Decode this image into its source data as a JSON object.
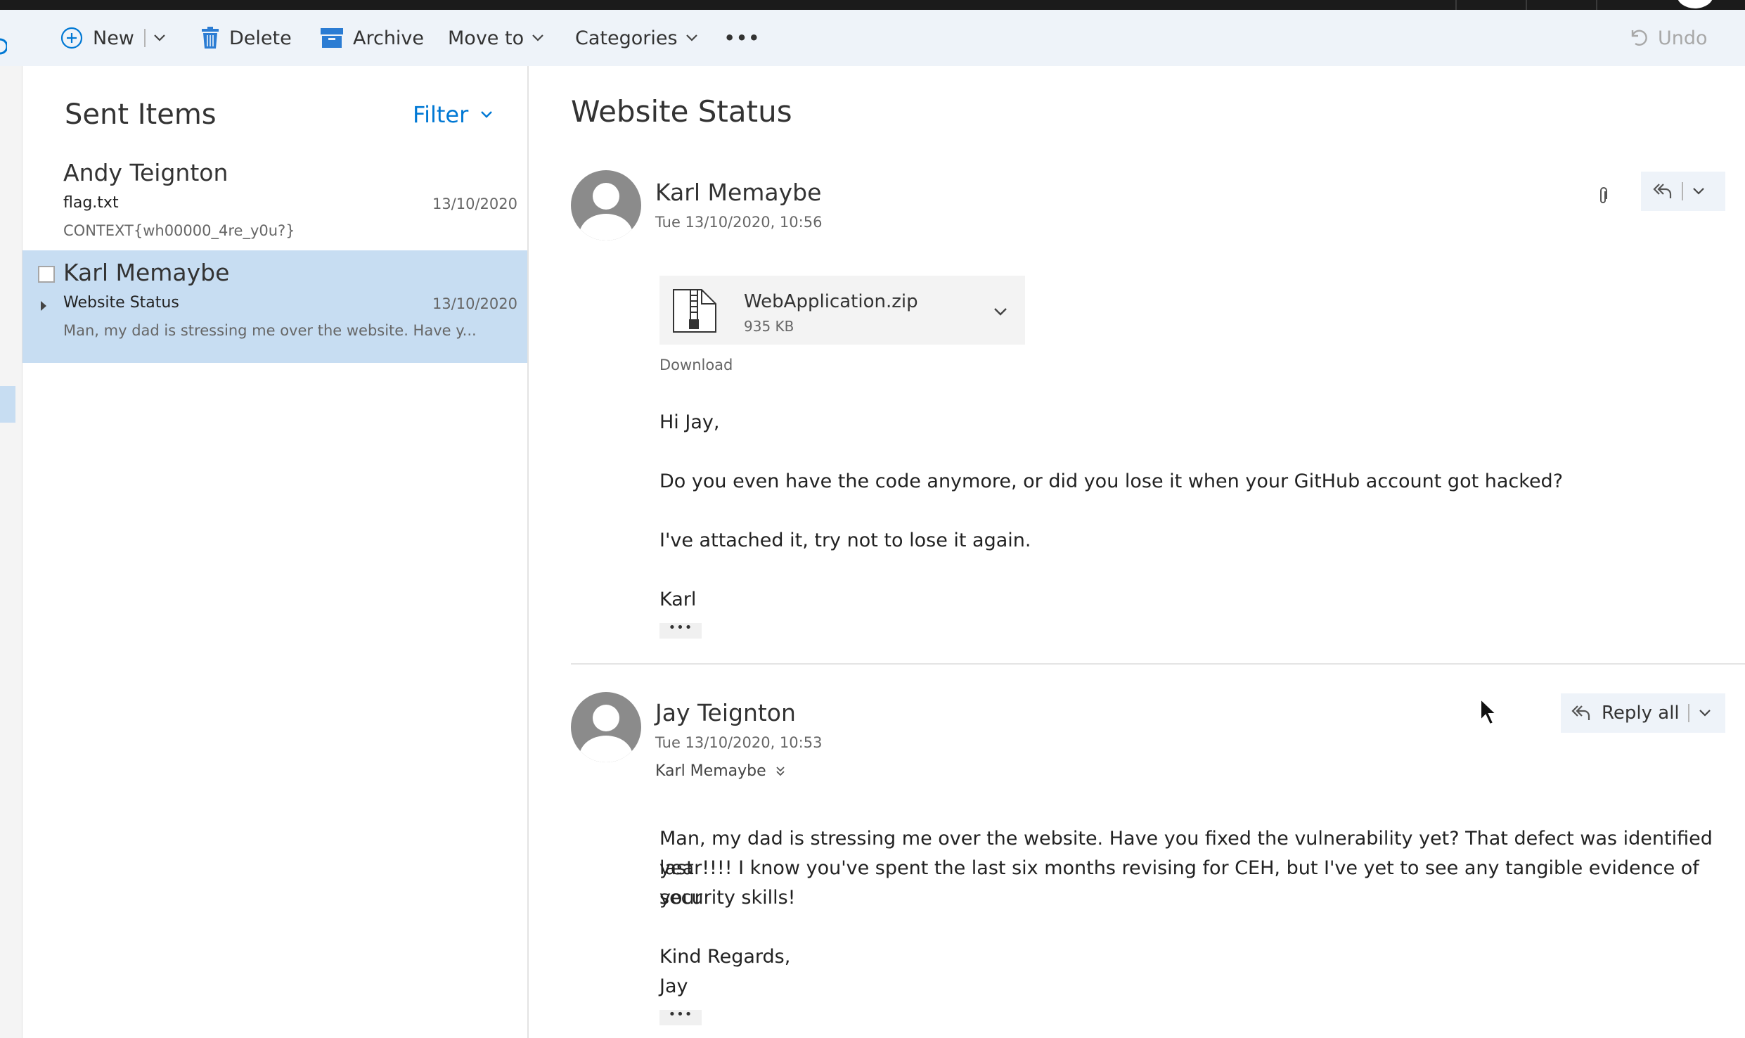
{
  "toolbar": {
    "new_label": "New",
    "delete_label": "Delete",
    "archive_label": "Archive",
    "move_to_label": "Move to",
    "categories_label": "Categories",
    "more_label": "•••",
    "undo_label": "Undo"
  },
  "folder": {
    "title": "Sent Items",
    "filter_label": "Filter"
  },
  "messages": [
    {
      "sender": "Andy Teignton",
      "subject": "flag.txt",
      "date": "13/10/2020",
      "preview": "CONTEXT{wh00000_4re_y0u?}",
      "selected": false
    },
    {
      "sender": "Karl Memaybe",
      "subject": "Website Status",
      "date": "13/10/2020",
      "preview": "Man, my dad is stressing me over the website. Have y...",
      "selected": true
    }
  ],
  "reading": {
    "subject": "Website Status",
    "messages": [
      {
        "sender": "Karl Memaybe",
        "datetime": "Tue 13/10/2020, 10:56",
        "attachment": {
          "name": "WebApplication.zip",
          "size": "935 KB",
          "download_label": "Download"
        },
        "body": [
          "Hi Jay,",
          "Do you even have the code anymore, or did you lose it when your GitHub account got hacked?",
          "I've attached it, try not to lose it again.",
          "Karl"
        ],
        "more_label": "•••"
      },
      {
        "sender": "Jay Teignton",
        "datetime": "Tue 13/10/2020, 10:53",
        "to": "Karl Memaybe",
        "reply_all_label": "Reply all",
        "body": [
          "Man, my dad is stressing me over the website. Have you fixed the vulnerability yet? That defect was identified last",
          "year!!!! I know you've spent the last six months revising for CEH, but I've yet to see any tangible evidence of your",
          "security skills!",
          "Kind Regards,",
          "Jay"
        ],
        "more_label": "•••"
      }
    ]
  },
  "colors": {
    "accent": "#0078d4",
    "toolbar_bg": "#eef3f9",
    "selected_row": "#c7ddf2",
    "archive_icon": "#2b7cd3"
  }
}
